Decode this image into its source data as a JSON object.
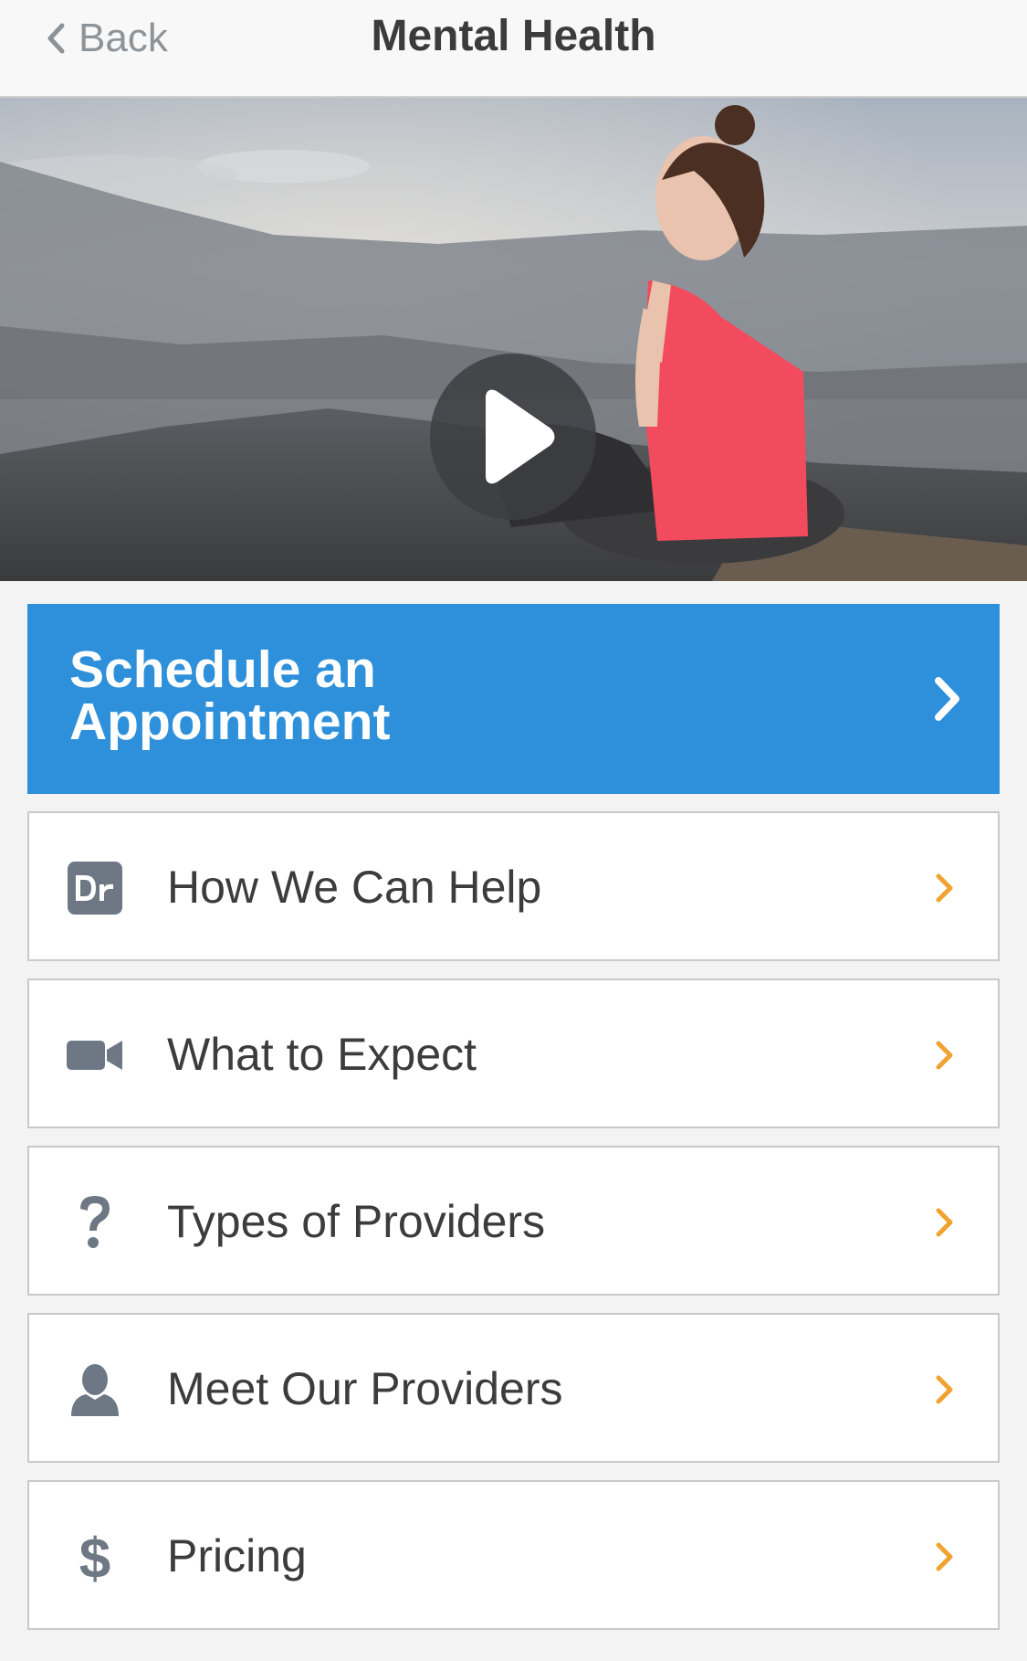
{
  "nav": {
    "back_label": "Back",
    "title": "Mental Health"
  },
  "hero": {
    "media": "video",
    "play_icon": "play-icon"
  },
  "cta": {
    "label": "Schedule an Appointment",
    "icon": "chevron-right-icon",
    "color": "#2e90db"
  },
  "menu": [
    {
      "label": "How We Can Help",
      "icon": "dr-badge-icon"
    },
    {
      "label": "What to Expect",
      "icon": "video-camera-icon"
    },
    {
      "label": "Types of Providers",
      "icon": "question-mark-icon"
    },
    {
      "label": "Meet Our Providers",
      "icon": "person-icon"
    },
    {
      "label": "Pricing",
      "icon": "dollar-icon"
    }
  ],
  "colors": {
    "accent_chevron": "#f0a332",
    "icon_gray": "#6e7884"
  }
}
